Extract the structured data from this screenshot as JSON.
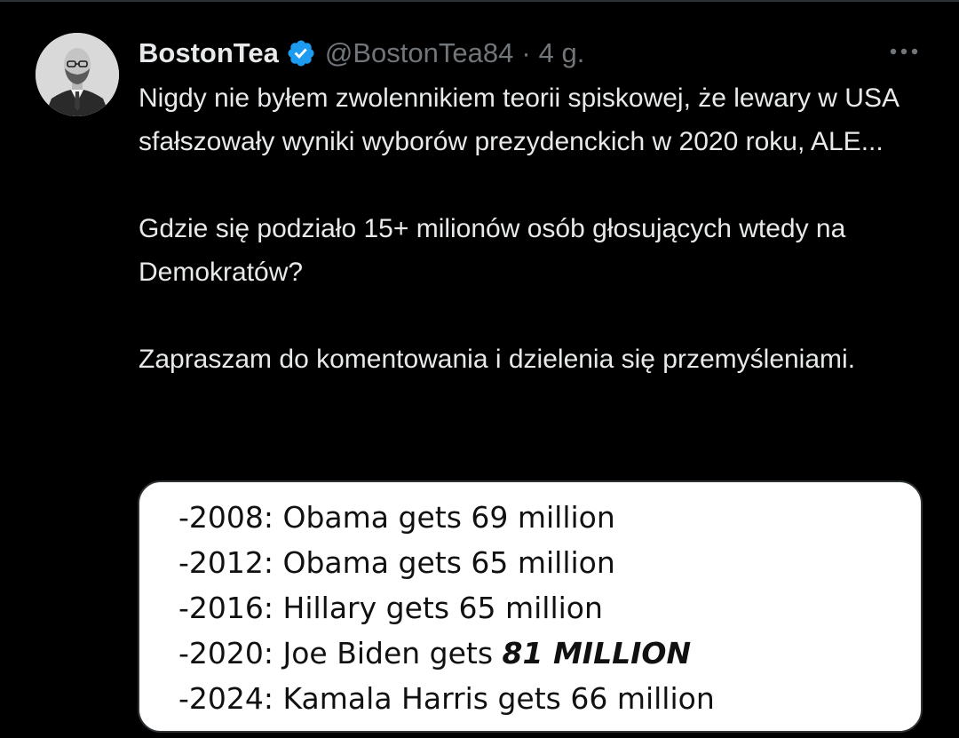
{
  "colors": {
    "background": "#000000",
    "text_primary": "#e7e9ea",
    "text_secondary": "#71767b",
    "verified_badge": "#1d9bf0",
    "divider": "#2f3336",
    "media_background": "#ffffff",
    "media_text": "#111111"
  },
  "author": {
    "display_name": "BostonTea",
    "verified_icon": "verified-badge-icon",
    "handle": "@BostonTea84",
    "separator": "·",
    "time": "4 g.",
    "avatar_icon": "profile-photo"
  },
  "more_icon": "more-options-icon",
  "tweet": {
    "paragraphs": [
      "Nigdy nie byłem zwolennikiem teorii spiskowej, że lewary w USA sfałszowały wyniki wyborów prezydenckich w 2020 roku, ALE...",
      "Gdzie się podziało 15+ milionów osób głosujących wtedy na Demokratów?",
      "Zapraszam do komentowania i dzielenia się przemyśleniami."
    ]
  },
  "media": {
    "lines": [
      {
        "text": "-2008: Obama gets 69 million",
        "emphasis": ""
      },
      {
        "text": "-2012: Obama gets 65 million",
        "emphasis": ""
      },
      {
        "text": "-2016: Hillary gets 65 million",
        "emphasis": ""
      },
      {
        "text": "-2020: Joe Biden gets ",
        "emphasis": "81 MILLION"
      },
      {
        "text": "-2024: Kamala Harris gets 66 million",
        "emphasis": ""
      }
    ]
  }
}
